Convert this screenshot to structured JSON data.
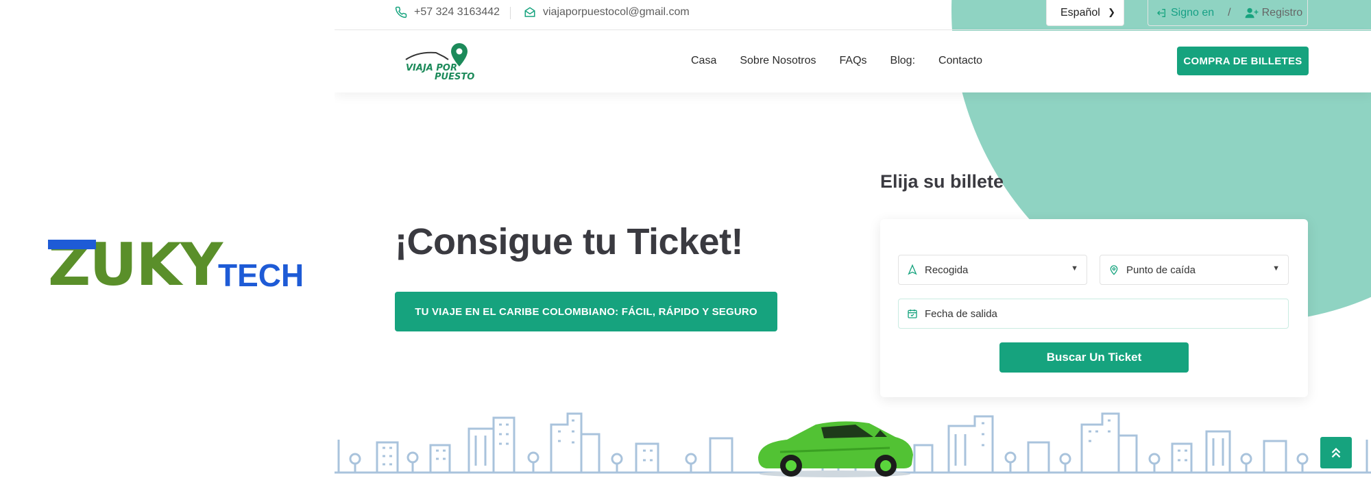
{
  "left_logo": {
    "brand_main": "ZUKY",
    "brand_sub": "TECH"
  },
  "topbar": {
    "phone": "+57 324 3163442",
    "email": "viajaporpuestocol@gmail.com",
    "language": "Español",
    "sign_in": "Signo en",
    "separator": "/",
    "register": "Registro"
  },
  "navbar": {
    "logo_text_1": "VIAJA POR",
    "logo_text_2": "PUESTO",
    "links": [
      "Casa",
      "Sobre Nosotros",
      "FAQs",
      "Blog:",
      "Contacto"
    ],
    "cta": "COMPRA DE BILLETES"
  },
  "hero": {
    "title": "¡Consigue tu Ticket!",
    "tagline": "TU VIAJE EN EL CARIBE COLOMBIANO: FÁCIL, RÁPIDO Y SEGURO"
  },
  "booking": {
    "title": "Elija su billete",
    "pickup_placeholder": "Recogida",
    "dropoff_placeholder": "Punto de caída",
    "date_placeholder": "Fecha de salida",
    "search_button": "Buscar Un Ticket"
  },
  "colors": {
    "accent": "#16a37e",
    "circle": "#8fd3c2",
    "brand_blue": "#1e5bd6",
    "brand_green": "#5a8f2a"
  },
  "icons": [
    "phone-icon",
    "mail-icon",
    "sign-in-icon",
    "user-plus-icon",
    "navigation-icon",
    "map-pin-icon",
    "calendar-icon",
    "chevron-up-icon"
  ]
}
